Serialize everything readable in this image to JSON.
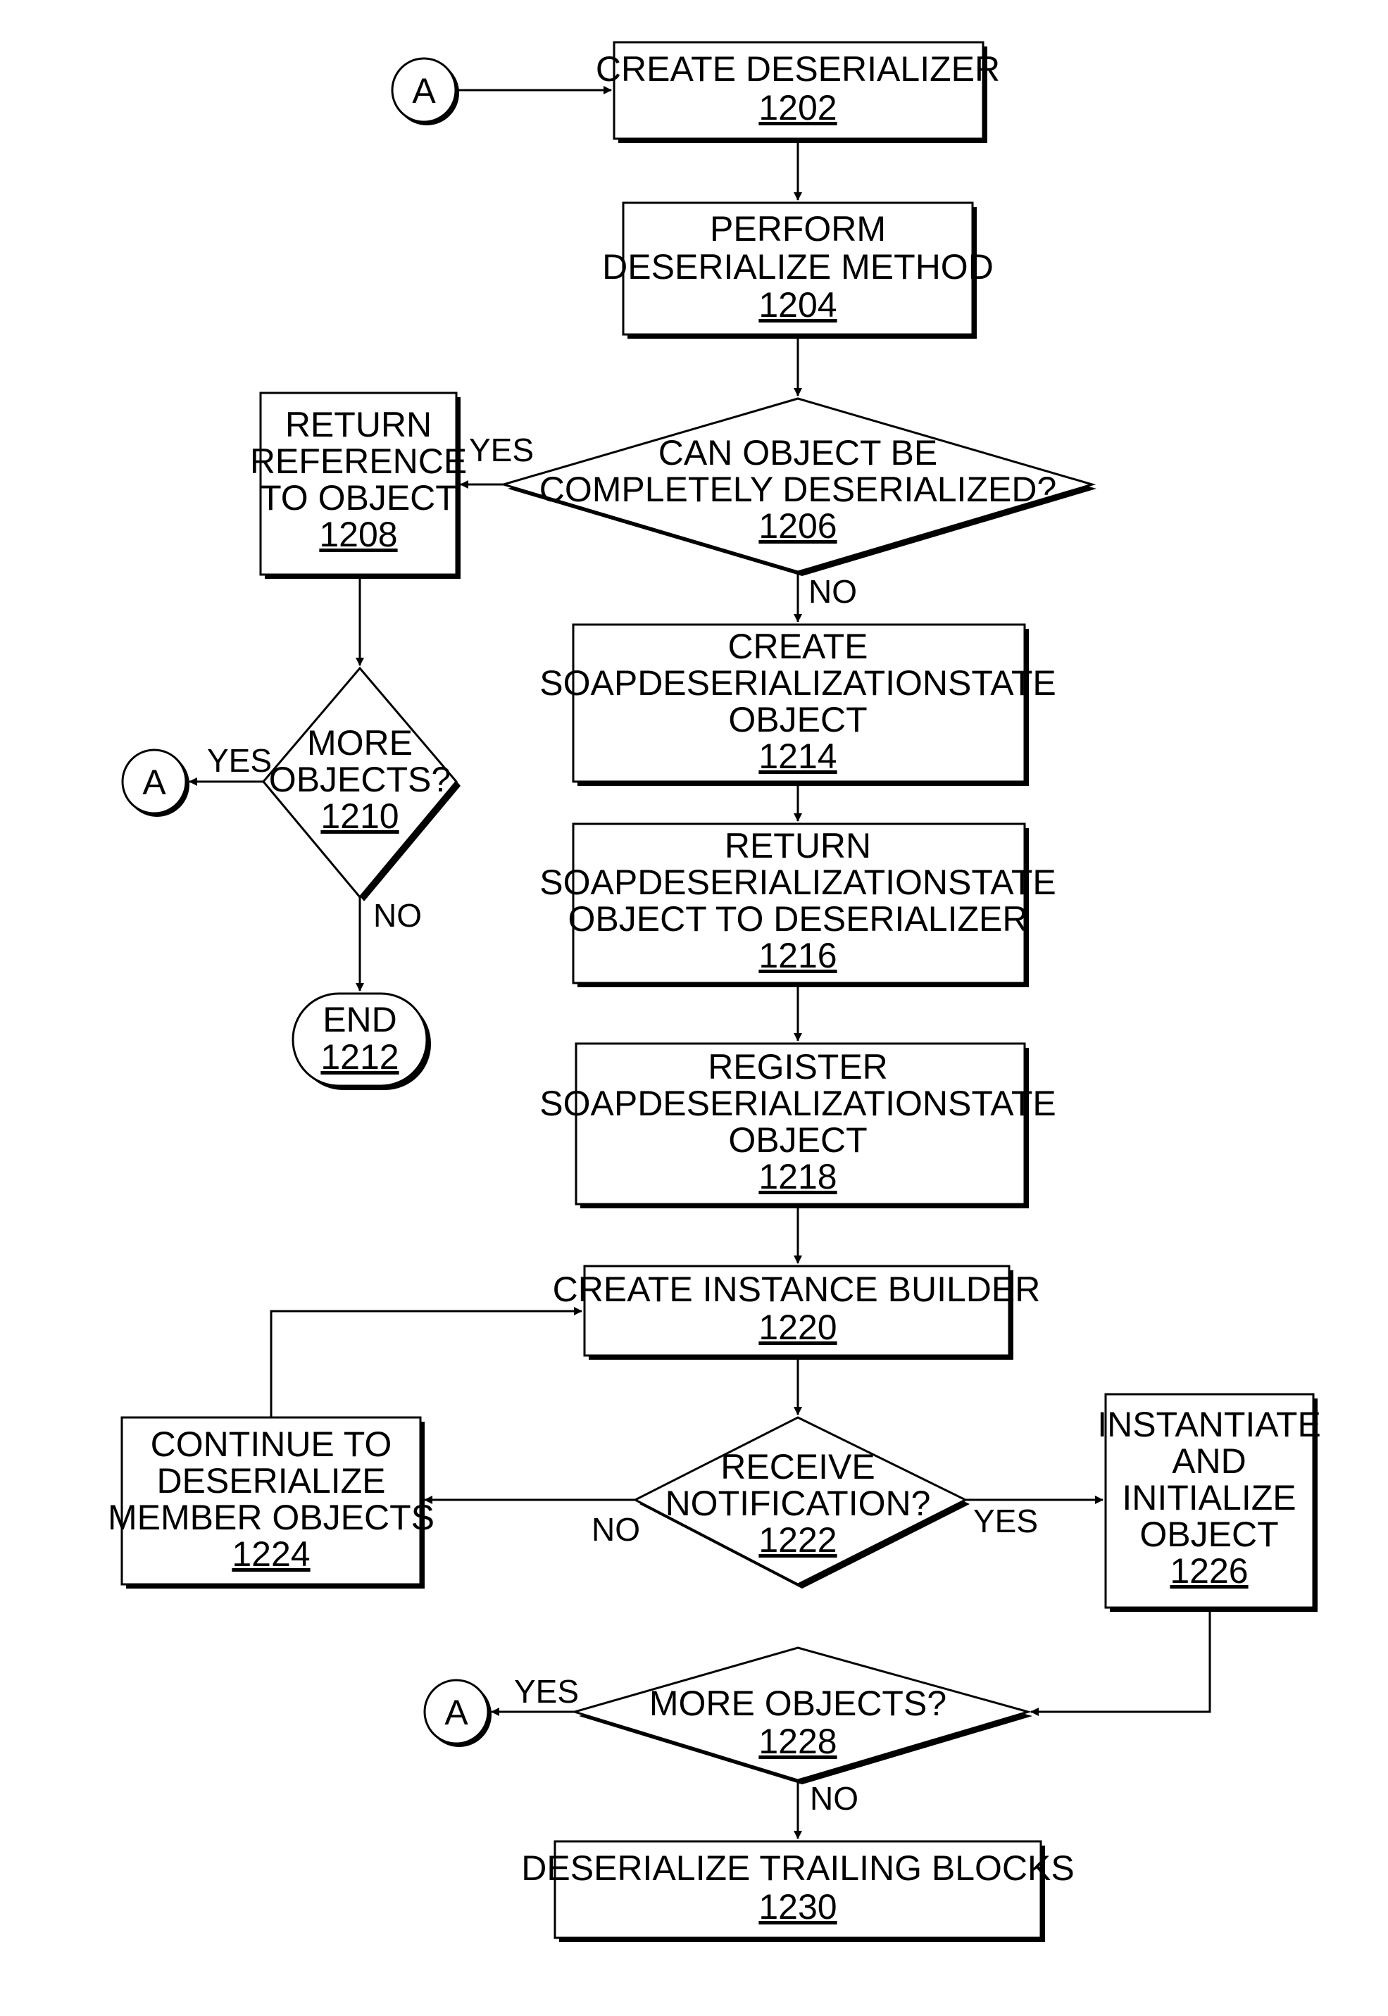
{
  "diagram": {
    "type": "flowchart",
    "connectors": {
      "top": "A",
      "left": "A",
      "bottom": "A"
    },
    "nodes": {
      "n1202": {
        "lines": [
          "CREATE DESERIALIZER"
        ],
        "ref": "1202",
        "shape": "process"
      },
      "n1204": {
        "lines": [
          "PERFORM",
          "DESERIALIZE METHOD"
        ],
        "ref": "1204",
        "shape": "process"
      },
      "n1206": {
        "lines": [
          "CAN OBJECT BE",
          "COMPLETELY DESERIALIZED?"
        ],
        "ref": "1206",
        "shape": "decision"
      },
      "n1208": {
        "lines": [
          "RETURN",
          "REFERENCE",
          "TO OBJECT"
        ],
        "ref": "1208",
        "shape": "process"
      },
      "n1210": {
        "lines": [
          "MORE",
          "OBJECTS?"
        ],
        "ref": "1210",
        "shape": "decision"
      },
      "n1212": {
        "lines": [
          "END"
        ],
        "ref": "1212",
        "shape": "terminator"
      },
      "n1214": {
        "lines": [
          "CREATE",
          "SOAPDESERIALIZATIONSTATE",
          "OBJECT"
        ],
        "ref": "1214",
        "shape": "process"
      },
      "n1216": {
        "lines": [
          "RETURN",
          "SOAPDESERIALIZATIONSTATE",
          "OBJECT TO DESERIALIZER"
        ],
        "ref": "1216",
        "shape": "process"
      },
      "n1218": {
        "lines": [
          "REGISTER",
          "SOAPDESERIALIZATIONSTATE",
          "OBJECT"
        ],
        "ref": "1218",
        "shape": "process"
      },
      "n1220": {
        "lines": [
          "CREATE INSTANCE BUILDER"
        ],
        "ref": "1220",
        "shape": "process"
      },
      "n1222": {
        "lines": [
          "RECEIVE",
          "NOTIFICATION?"
        ],
        "ref": "1222",
        "shape": "decision"
      },
      "n1224": {
        "lines": [
          "CONTINUE TO",
          "DESERIALIZE",
          "MEMBER OBJECTS"
        ],
        "ref": "1224",
        "shape": "process"
      },
      "n1226": {
        "lines": [
          "INSTANTIATE",
          "AND",
          "INITIALIZE",
          "OBJECT"
        ],
        "ref": "1226",
        "shape": "process"
      },
      "n1228": {
        "lines": [
          "MORE OBJECTS?"
        ],
        "ref": "1228",
        "shape": "decision"
      },
      "n1230": {
        "lines": [
          "DESERIALIZE TRAILING BLOCKS"
        ],
        "ref": "1230",
        "shape": "process"
      }
    },
    "edge_labels": {
      "e1206_yes": "YES",
      "e1206_no": "NO",
      "e1210_yes": "YES",
      "e1210_no": "NO",
      "e1222_no": "NO",
      "e1222_yes": "YES",
      "e1228_yes": "YES",
      "e1228_no": "NO"
    },
    "edges": [
      {
        "from": "A",
        "to": "1202"
      },
      {
        "from": "1202",
        "to": "1204"
      },
      {
        "from": "1204",
        "to": "1206"
      },
      {
        "from": "1206",
        "to": "1208",
        "label": "YES"
      },
      {
        "from": "1206",
        "to": "1214",
        "label": "NO"
      },
      {
        "from": "1208",
        "to": "1210"
      },
      {
        "from": "1210",
        "to": "A",
        "label": "YES"
      },
      {
        "from": "1210",
        "to": "1212",
        "label": "NO"
      },
      {
        "from": "1214",
        "to": "1216"
      },
      {
        "from": "1216",
        "to": "1218"
      },
      {
        "from": "1218",
        "to": "1220"
      },
      {
        "from": "1220",
        "to": "1222"
      },
      {
        "from": "1222",
        "to": "1224",
        "label": "NO"
      },
      {
        "from": "1222",
        "to": "1226",
        "label": "YES"
      },
      {
        "from": "1224",
        "to": "1220"
      },
      {
        "from": "1226",
        "to": "1228"
      },
      {
        "from": "1228",
        "to": "A",
        "label": "YES"
      },
      {
        "from": "1228",
        "to": "1230",
        "label": "NO"
      }
    ]
  }
}
